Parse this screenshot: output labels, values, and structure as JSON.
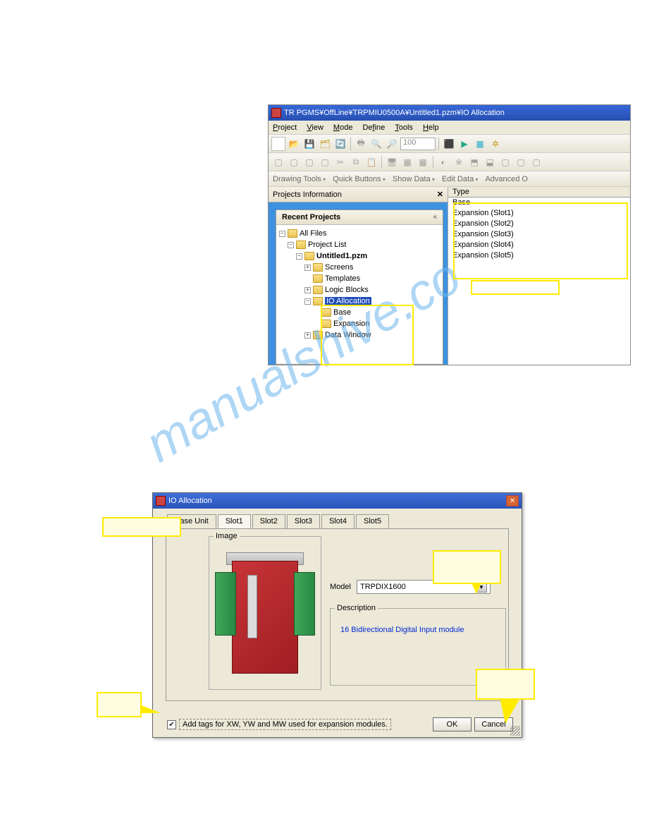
{
  "win1": {
    "title": "TR PGMS¥OffLine¥TRPMIU0500A¥Untitled1.pzm¥IO Allocation",
    "menu": [
      "Project",
      "View",
      "Mode",
      "Define",
      "Tools",
      "Help"
    ],
    "zoom": "100",
    "toolstrip": [
      "Drawing Tools",
      "Quick Buttons",
      "Show Data",
      "Edit Data",
      "Advanced O"
    ],
    "projects_panel_title": "Projects Information",
    "recent_label": "Recent Projects",
    "tree": {
      "root": "All Files",
      "project_list": "Project List",
      "project_name": "Untitled1.pzm",
      "screens": "Screens",
      "templates": "Templates",
      "logic_blocks": "Logic Blocks",
      "io_allocation": "IO Allocation",
      "base": "Base",
      "expansion": "Expansion",
      "data_window": "Data Window"
    },
    "type_header": "Type",
    "type_items": [
      "Base",
      "Expansion (Slot1)",
      "Expansion (Slot2)",
      "Expansion (Slot3)",
      "Expansion (Slot4)",
      "Expansion (Slot5)"
    ]
  },
  "win2": {
    "title": "IO Allocation",
    "tabs": [
      "Base Unit",
      "Slot1",
      "Slot2",
      "Slot3",
      "Slot4",
      "Slot5"
    ],
    "image_label": "Image",
    "model_label": "Model",
    "model_value": "TRPDIX1600",
    "desc_label": "Description",
    "desc_text": "16 Bidirectional Digital Input module",
    "checkbox_label": "Add tags for XW, YW and MW used for expansion  modules.",
    "ok": "OK",
    "cancel": "Cancel"
  }
}
